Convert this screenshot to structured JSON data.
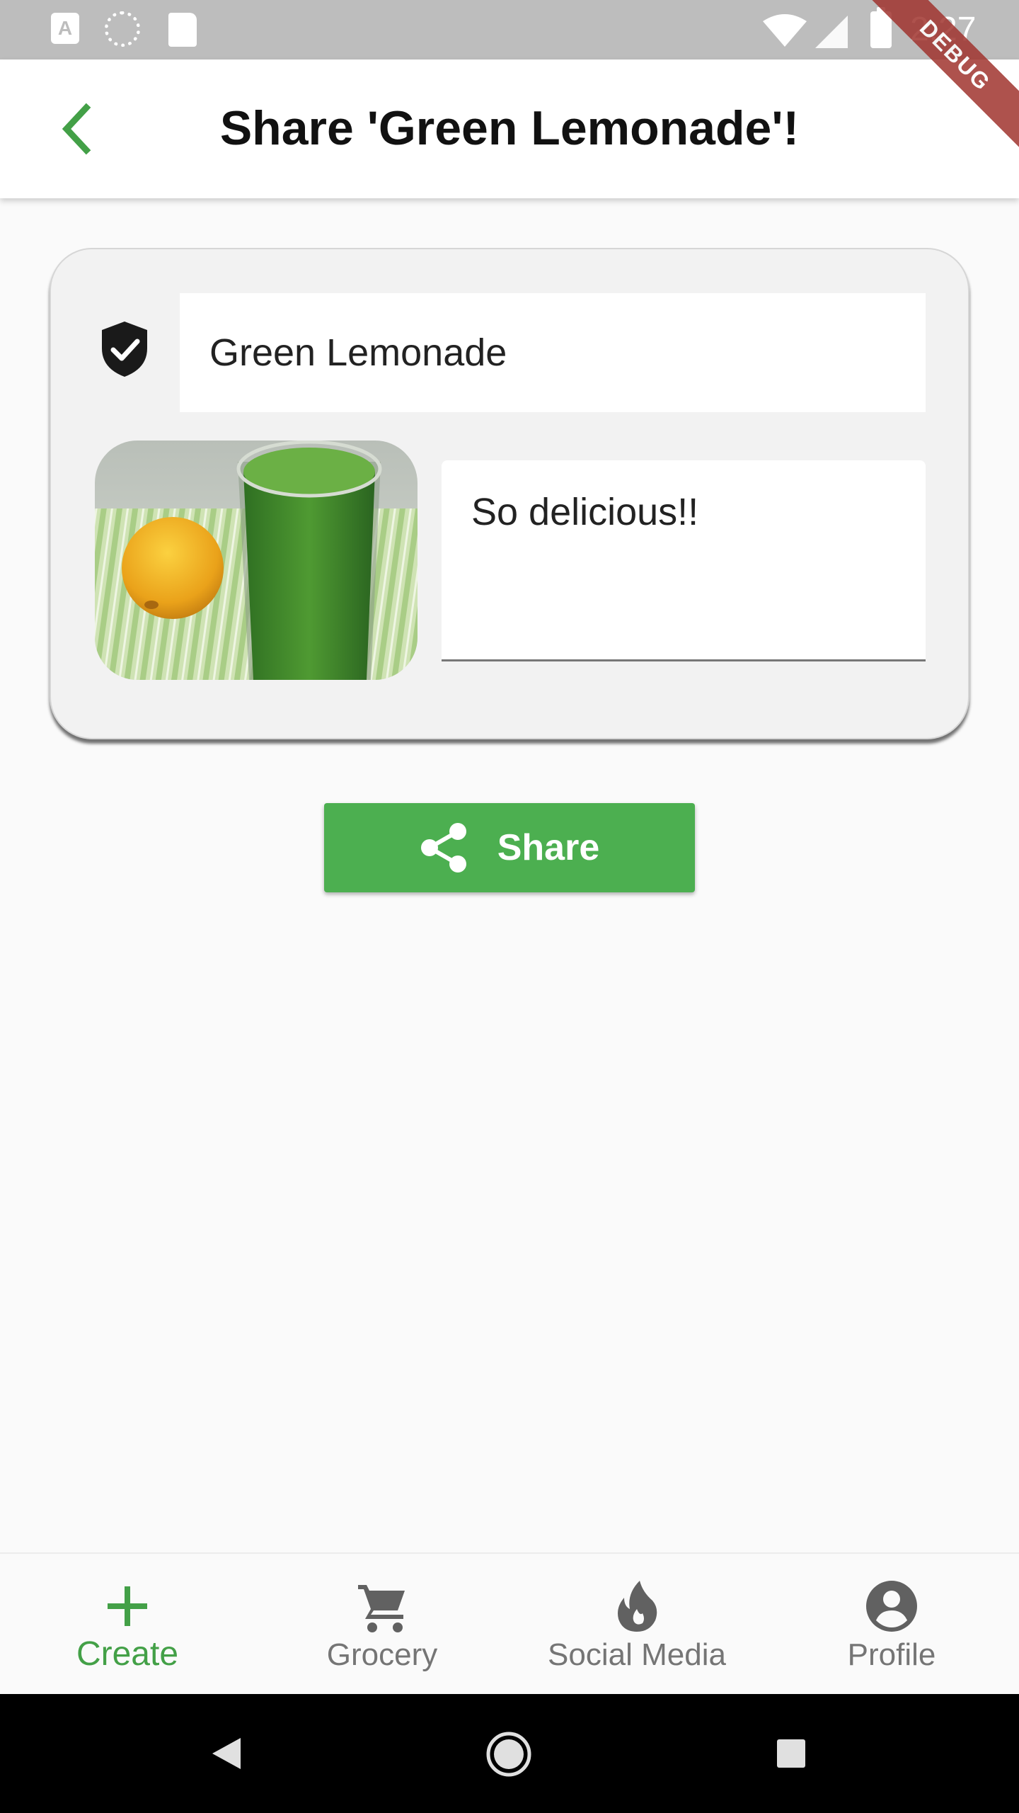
{
  "status_bar": {
    "time": "2:27",
    "notification_a": "A"
  },
  "debug_banner": "DEBUG",
  "app_bar": {
    "title": "Share 'Green Lemonade'!"
  },
  "card": {
    "recipe_name_value": "Green Lemonade",
    "description_value": "So delicious!!"
  },
  "share_button": {
    "label": "Share"
  },
  "bottom_nav": {
    "items": [
      {
        "label": "Create",
        "icon": "plus-icon",
        "active": true
      },
      {
        "label": "Grocery",
        "icon": "cart-icon",
        "active": false
      },
      {
        "label": "Social Media",
        "icon": "flame-icon",
        "active": false
      },
      {
        "label": "Profile",
        "icon": "account-icon",
        "active": false
      }
    ]
  },
  "colors": {
    "accent": "#4caf50",
    "active_nav": "#43a047",
    "inactive_nav": "#757575"
  }
}
